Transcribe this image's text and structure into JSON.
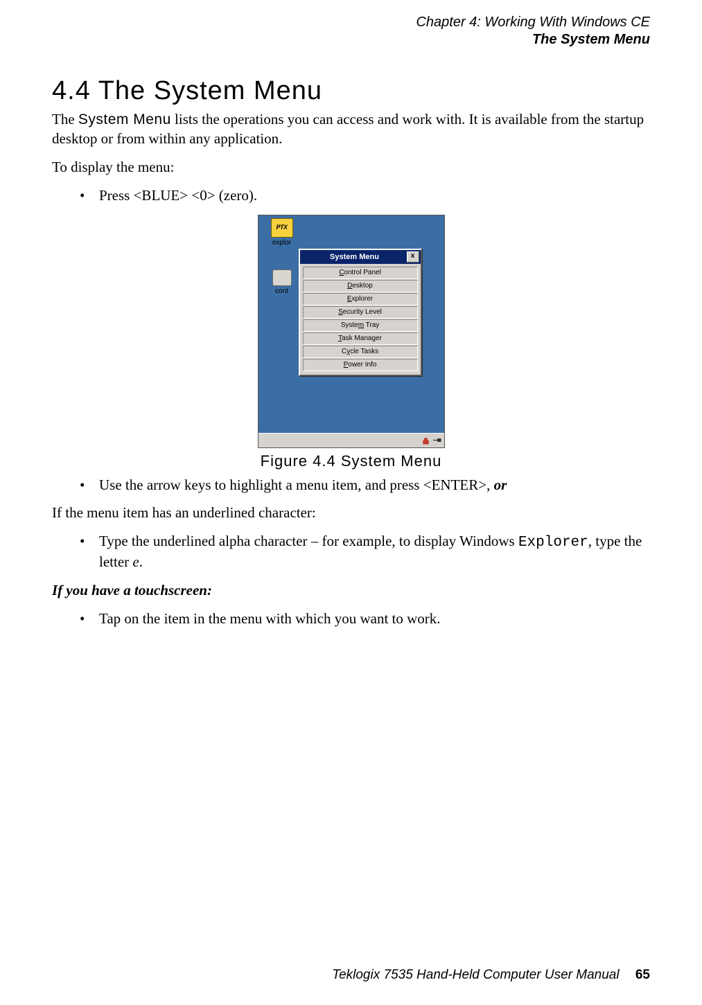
{
  "header": {
    "line1": "Chapter 4: Working With Windows CE",
    "line2": "The System Menu"
  },
  "section": {
    "number_title": "4.4  The System Menu"
  },
  "intro": {
    "pre": "The ",
    "sysmenu": "System Menu",
    "post": " lists the operations you can access and work with. It is available from the startup desktop or from within any application."
  },
  "to_display": "To display the menu:",
  "bullet_press": "Press <BLUE> <0> (zero).",
  "figure": {
    "caption": "Figure 4.4 System Menu",
    "desktop_icons": {
      "explor": "explor",
      "cont": "cont",
      "ptx": "PTX"
    },
    "window_title": "System Menu",
    "close_label": "x",
    "items": [
      {
        "u": "C",
        "rest": "ontrol Panel"
      },
      {
        "u": "D",
        "rest": "esktop"
      },
      {
        "u": "E",
        "rest": "xplorer"
      },
      {
        "u": "S",
        "rest": "ecurity Level"
      },
      {
        "pre": "Syste",
        "u": "m",
        "rest": " Tray"
      },
      {
        "u": "T",
        "rest": "ask Manager"
      },
      {
        "pre": "C",
        "u": "y",
        "rest": "cle Tasks"
      },
      {
        "u": "P",
        "rest": "ower Info"
      }
    ]
  },
  "bullet_arrow": {
    "pre": "Use the arrow keys to highlight a menu item, and press <ENTER>, ",
    "or": "or"
  },
  "underline_intro": "If the menu item has an underlined character:",
  "bullet_type": {
    "pre": "Type the underlined alpha character – for example, to display Windows ",
    "code": "Explorer",
    "mid": ", type the letter ",
    "e": "e",
    "post": "."
  },
  "touch_heading": "If you have a touchscreen:",
  "bullet_tap": "Tap on the item in the menu with which you want to work.",
  "footer": {
    "text": "Teklogix 7535 Hand-Held Computer User Manual",
    "page": "65"
  }
}
